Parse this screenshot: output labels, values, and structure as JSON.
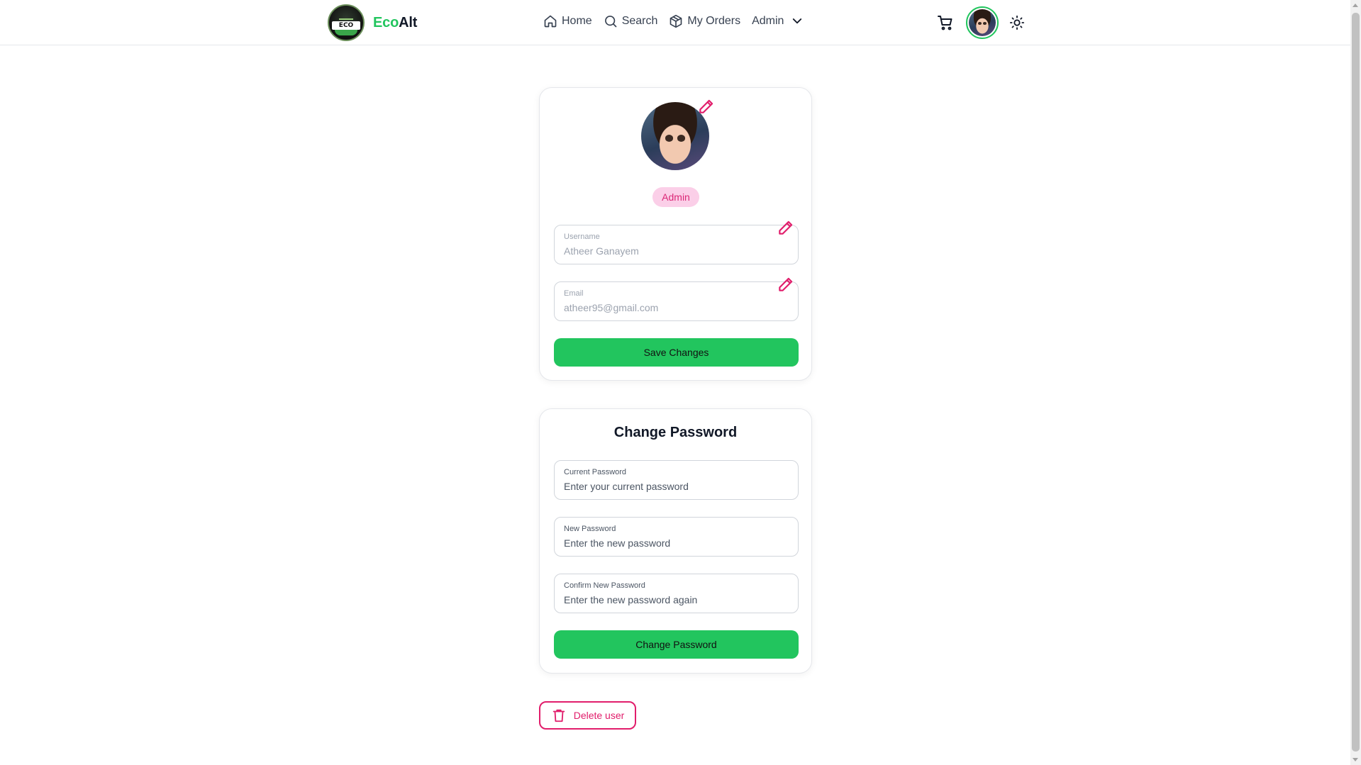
{
  "header": {
    "brand_eco": "Eco",
    "brand_alt": "Alt",
    "logo_text": "ECO ALT",
    "nav": [
      {
        "label": "Home",
        "icon": "home-icon"
      },
      {
        "label": "Search",
        "icon": "search-icon"
      },
      {
        "label": "My Orders",
        "icon": "package-icon"
      },
      {
        "label": "Admin",
        "icon": "chevron-down-icon"
      }
    ]
  },
  "profile": {
    "role": "Admin",
    "username_label": "Username",
    "username_value": "Atheer Ganayem",
    "email_label": "Email",
    "email_value": "atheer95@gmail.com",
    "save_label": "Save Changes"
  },
  "password": {
    "title": "Change Password",
    "current_label": "Current Password",
    "current_placeholder": "Enter your current password",
    "new_label": "New Password",
    "new_placeholder": "Enter the new password",
    "confirm_label": "Confirm New Password",
    "confirm_placeholder": "Enter the new password again",
    "submit_label": "Change Password"
  },
  "delete_label": "Delete user",
  "colors": {
    "accent_green": "#22c55e",
    "accent_pink": "#e11d6b",
    "badge_bg": "#fbcfe8"
  }
}
